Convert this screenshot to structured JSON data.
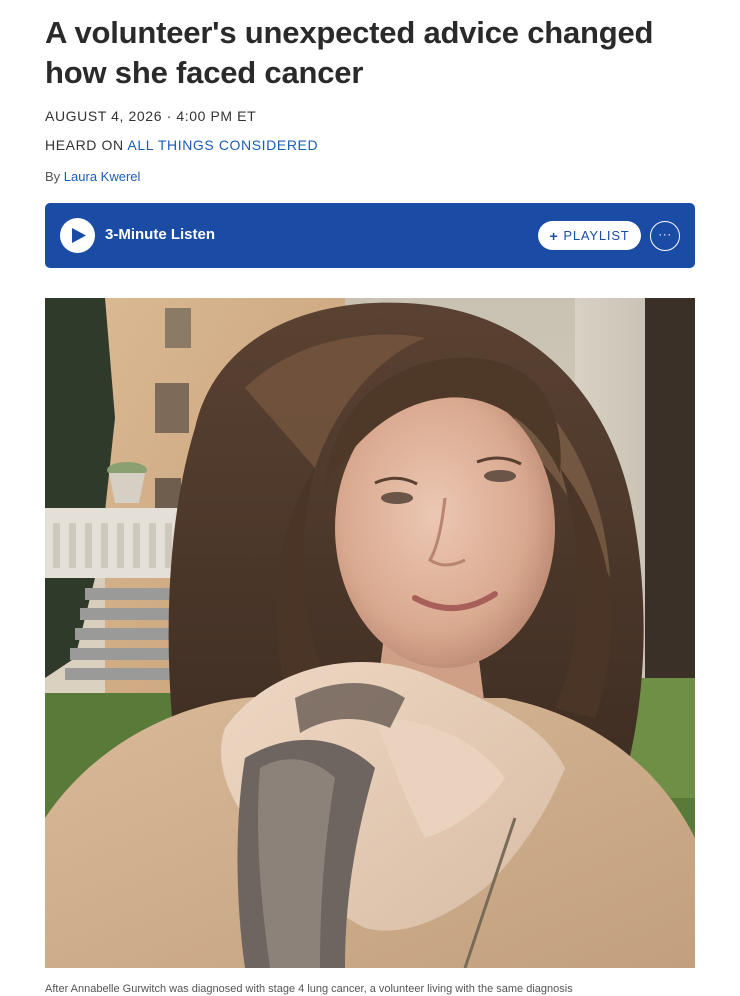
{
  "article": {
    "headline": "A volunteer's unexpected advice changed how she faced cancer",
    "date": "AUGUST 4, 2026 · 4:00 PM ET",
    "heard_on_prefix": "HEARD ON ",
    "program": "ALL THINGS CONSIDERED",
    "byline_prefix": "By ",
    "author": "Laura Kwerel"
  },
  "audio": {
    "listen_label": "3-Minute Listen",
    "playlist_plus": "+",
    "playlist_label": "PLAYLIST",
    "more_label": "···",
    "colors": {
      "player_bg": "#1a4ca6"
    }
  },
  "photo": {
    "caption": "After Annabelle Gurwitch was diagnosed with stage 4 lung cancer, a volunteer living with the same diagnosis"
  },
  "colors": {
    "link": "#1a5eb8",
    "text": "#2a2a2a"
  }
}
